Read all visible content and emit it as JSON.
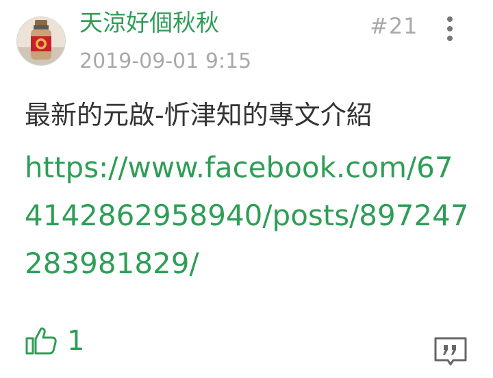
{
  "post": {
    "author": "天涼好個秋秋",
    "timestamp": "2019-09-01 9:15",
    "floor": "#21",
    "text": "最新的元啟-忻津知的專文介紹",
    "link": "https://www.facebook.com/674142862958940/posts/897247283981829/",
    "likes": "1"
  },
  "colors": {
    "accent": "#2e9e56",
    "muted": "#a9a9a9",
    "text": "#333333"
  },
  "icons": {
    "more": "more-vertical-icon",
    "like": "thumbs-up-icon",
    "reply": "quote-reply-icon"
  }
}
